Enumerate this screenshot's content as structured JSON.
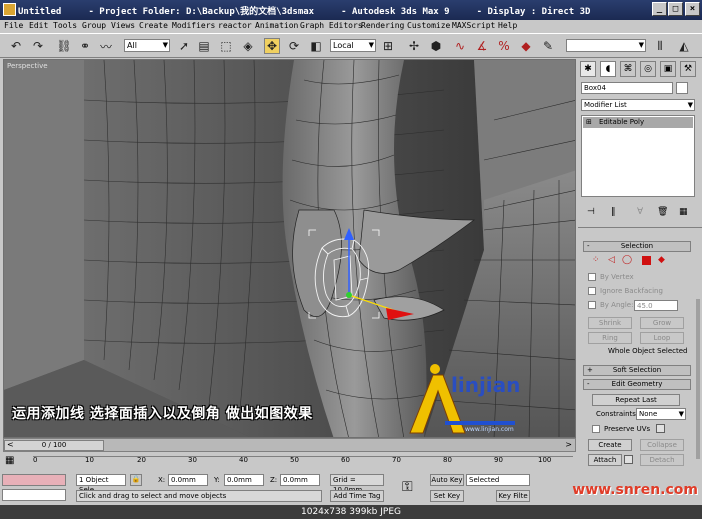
{
  "window": {
    "title": "Untitled     - Project Folder: D:\\Backup\\我的文档\\3dsmax     - Autodesk 3ds Max 9     - Display : Direct 3D",
    "min": "_",
    "max": "□",
    "close": "×"
  },
  "menu": [
    "File",
    "Edit",
    "Tools",
    "Group",
    "Views",
    "Create",
    "Modifiers",
    "reactor",
    "Animation",
    "Graph Editors",
    "Rendering",
    "Customize",
    "MAXScript",
    "Help"
  ],
  "toolbar": {
    "selection_filter": "All",
    "coord_system": "Local"
  },
  "viewport": {
    "label": "Perspective",
    "subtitle": "运用添加线 选择面插入以及倒角 做出如图效果"
  },
  "logo": {
    "text": "linjian",
    "url": "www.linjian.com"
  },
  "command_panel": {
    "object_name": "Box04",
    "modifier_list": "Modifier List",
    "stack_item": "Editable Poly",
    "selection_title": "Selection",
    "by_vertex": "By Vertex",
    "ignore_backfacing": "Ignore Backfacing",
    "by_angle": "By Angle:",
    "angle_value": "45.0",
    "shrink": "Shrink",
    "grow": "Grow",
    "ring": "Ring",
    "loop": "Loop",
    "selection_status": "Whole Object Selected",
    "soft_selection": "Soft Selection",
    "edit_geometry": "Edit Geometry",
    "repeat_last": "Repeat Last",
    "constraints_label": "Constraints:",
    "constraints_value": "None",
    "preserve_uvs": "Preserve UVs",
    "create": "Create",
    "collapse": "Collapse",
    "attach": "Attach",
    "detach": "Detach"
  },
  "timeline": {
    "frame": "0 / 100",
    "ticks": [
      "0",
      "10",
      "20",
      "30",
      "40",
      "50",
      "60",
      "70",
      "80",
      "90",
      "100"
    ]
  },
  "status": {
    "selection": "1 Object Sele",
    "x_label": "X:",
    "x": "0.0mm",
    "y_label": "Y:",
    "y": "0.0mm",
    "z_label": "Z:",
    "z": "0.0mm",
    "grid": "Grid = 10.0mm",
    "prompt": "Click and drag to select and move objects",
    "add_time_tag": "Add Time Tag",
    "auto_key": "Auto Key",
    "set_key": "Set Key",
    "key_mode": "Selected",
    "key_filters": "Key Filte"
  },
  "watermark": "www.snren.com",
  "caption": "1024x738  399kb  JPEG"
}
